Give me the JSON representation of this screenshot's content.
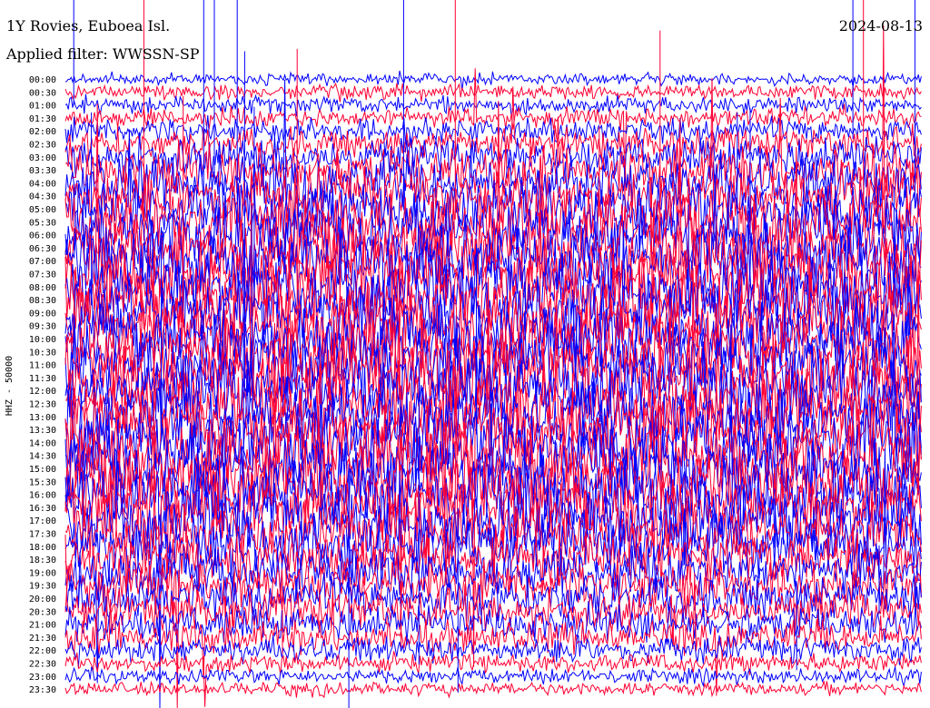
{
  "header": {
    "station": "1Y Rovies, Euboea Isl.",
    "date": "2024-08-13",
    "filter": "Applied filter: WWSSN-SP"
  },
  "chart_data": {
    "type": "line",
    "title": "1Y Rovies, Euboea Isl.",
    "subtitle": "Applied filter: WWSSN-SP",
    "date": "2024-08-13",
    "ylabel": "HHZ - 50000",
    "rows": [
      "00:00",
      "00:30",
      "01:00",
      "01:30",
      "02:00",
      "02:30",
      "03:00",
      "03:30",
      "04:00",
      "04:30",
      "05:00",
      "05:30",
      "06:00",
      "06:30",
      "07:00",
      "07:30",
      "08:00",
      "08:30",
      "09:00",
      "09:30",
      "10:00",
      "10:30",
      "11:00",
      "11:30",
      "12:00",
      "12:30",
      "13:00",
      "13:30",
      "14:00",
      "14:30",
      "15:00",
      "15:30",
      "16:00",
      "16:30",
      "17:00",
      "17:30",
      "18:00",
      "18:30",
      "19:00",
      "19:30",
      "20:00",
      "20:30",
      "21:00",
      "21:30",
      "22:00",
      "22:30",
      "23:00",
      "23:30"
    ],
    "row_colors": [
      "#0000ff",
      "#ff0033"
    ],
    "activity_level": [
      0.08,
      0.12,
      0.15,
      0.2,
      0.28,
      0.35,
      0.5,
      0.6,
      0.7,
      0.75,
      0.8,
      0.85,
      0.9,
      0.92,
      0.95,
      1.0,
      1.0,
      1.0,
      1.0,
      1.0,
      1.0,
      1.0,
      1.0,
      1.0,
      1.0,
      1.0,
      1.0,
      1.0,
      1.0,
      1.0,
      1.0,
      1.0,
      1.0,
      0.95,
      0.9,
      0.85,
      0.8,
      0.7,
      0.65,
      0.6,
      0.55,
      0.5,
      0.45,
      0.4,
      0.3,
      0.18,
      0.12,
      0.1
    ],
    "grid": false
  }
}
